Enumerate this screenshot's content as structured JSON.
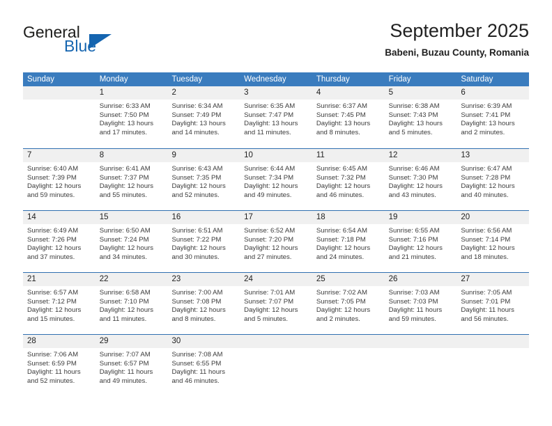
{
  "brand": {
    "word1": "General",
    "word2": "Blue",
    "logo_icon": "blue-triangle-icon",
    "accent_color": "#1565b0"
  },
  "header": {
    "title": "September 2025",
    "location": "Babeni, Buzau County, Romania"
  },
  "calendar": {
    "header_bg": "#3a7cbe",
    "row_divider": "#2f6fb0",
    "date_band_bg": "#f0f0f0",
    "weekdays": [
      "Sunday",
      "Monday",
      "Tuesday",
      "Wednesday",
      "Thursday",
      "Friday",
      "Saturday"
    ],
    "weeks": [
      [
        {
          "date": "",
          "sunrise": "",
          "sunset": "",
          "daylight_line1": "",
          "daylight_line2": "",
          "empty": true
        },
        {
          "date": "1",
          "sunrise": "Sunrise: 6:33 AM",
          "sunset": "Sunset: 7:50 PM",
          "daylight_line1": "Daylight: 13 hours",
          "daylight_line2": "and 17 minutes."
        },
        {
          "date": "2",
          "sunrise": "Sunrise: 6:34 AM",
          "sunset": "Sunset: 7:49 PM",
          "daylight_line1": "Daylight: 13 hours",
          "daylight_line2": "and 14 minutes."
        },
        {
          "date": "3",
          "sunrise": "Sunrise: 6:35 AM",
          "sunset": "Sunset: 7:47 PM",
          "daylight_line1": "Daylight: 13 hours",
          "daylight_line2": "and 11 minutes."
        },
        {
          "date": "4",
          "sunrise": "Sunrise: 6:37 AM",
          "sunset": "Sunset: 7:45 PM",
          "daylight_line1": "Daylight: 13 hours",
          "daylight_line2": "and 8 minutes."
        },
        {
          "date": "5",
          "sunrise": "Sunrise: 6:38 AM",
          "sunset": "Sunset: 7:43 PM",
          "daylight_line1": "Daylight: 13 hours",
          "daylight_line2": "and 5 minutes."
        },
        {
          "date": "6",
          "sunrise": "Sunrise: 6:39 AM",
          "sunset": "Sunset: 7:41 PM",
          "daylight_line1": "Daylight: 13 hours",
          "daylight_line2": "and 2 minutes."
        }
      ],
      [
        {
          "date": "7",
          "sunrise": "Sunrise: 6:40 AM",
          "sunset": "Sunset: 7:39 PM",
          "daylight_line1": "Daylight: 12 hours",
          "daylight_line2": "and 59 minutes."
        },
        {
          "date": "8",
          "sunrise": "Sunrise: 6:41 AM",
          "sunset": "Sunset: 7:37 PM",
          "daylight_line1": "Daylight: 12 hours",
          "daylight_line2": "and 55 minutes."
        },
        {
          "date": "9",
          "sunrise": "Sunrise: 6:43 AM",
          "sunset": "Sunset: 7:35 PM",
          "daylight_line1": "Daylight: 12 hours",
          "daylight_line2": "and 52 minutes."
        },
        {
          "date": "10",
          "sunrise": "Sunrise: 6:44 AM",
          "sunset": "Sunset: 7:34 PM",
          "daylight_line1": "Daylight: 12 hours",
          "daylight_line2": "and 49 minutes."
        },
        {
          "date": "11",
          "sunrise": "Sunrise: 6:45 AM",
          "sunset": "Sunset: 7:32 PM",
          "daylight_line1": "Daylight: 12 hours",
          "daylight_line2": "and 46 minutes."
        },
        {
          "date": "12",
          "sunrise": "Sunrise: 6:46 AM",
          "sunset": "Sunset: 7:30 PM",
          "daylight_line1": "Daylight: 12 hours",
          "daylight_line2": "and 43 minutes."
        },
        {
          "date": "13",
          "sunrise": "Sunrise: 6:47 AM",
          "sunset": "Sunset: 7:28 PM",
          "daylight_line1": "Daylight: 12 hours",
          "daylight_line2": "and 40 minutes."
        }
      ],
      [
        {
          "date": "14",
          "sunrise": "Sunrise: 6:49 AM",
          "sunset": "Sunset: 7:26 PM",
          "daylight_line1": "Daylight: 12 hours",
          "daylight_line2": "and 37 minutes."
        },
        {
          "date": "15",
          "sunrise": "Sunrise: 6:50 AM",
          "sunset": "Sunset: 7:24 PM",
          "daylight_line1": "Daylight: 12 hours",
          "daylight_line2": "and 34 minutes."
        },
        {
          "date": "16",
          "sunrise": "Sunrise: 6:51 AM",
          "sunset": "Sunset: 7:22 PM",
          "daylight_line1": "Daylight: 12 hours",
          "daylight_line2": "and 30 minutes."
        },
        {
          "date": "17",
          "sunrise": "Sunrise: 6:52 AM",
          "sunset": "Sunset: 7:20 PM",
          "daylight_line1": "Daylight: 12 hours",
          "daylight_line2": "and 27 minutes."
        },
        {
          "date": "18",
          "sunrise": "Sunrise: 6:54 AM",
          "sunset": "Sunset: 7:18 PM",
          "daylight_line1": "Daylight: 12 hours",
          "daylight_line2": "and 24 minutes."
        },
        {
          "date": "19",
          "sunrise": "Sunrise: 6:55 AM",
          "sunset": "Sunset: 7:16 PM",
          "daylight_line1": "Daylight: 12 hours",
          "daylight_line2": "and 21 minutes."
        },
        {
          "date": "20",
          "sunrise": "Sunrise: 6:56 AM",
          "sunset": "Sunset: 7:14 PM",
          "daylight_line1": "Daylight: 12 hours",
          "daylight_line2": "and 18 minutes."
        }
      ],
      [
        {
          "date": "21",
          "sunrise": "Sunrise: 6:57 AM",
          "sunset": "Sunset: 7:12 PM",
          "daylight_line1": "Daylight: 12 hours",
          "daylight_line2": "and 15 minutes."
        },
        {
          "date": "22",
          "sunrise": "Sunrise: 6:58 AM",
          "sunset": "Sunset: 7:10 PM",
          "daylight_line1": "Daylight: 12 hours",
          "daylight_line2": "and 11 minutes."
        },
        {
          "date": "23",
          "sunrise": "Sunrise: 7:00 AM",
          "sunset": "Sunset: 7:08 PM",
          "daylight_line1": "Daylight: 12 hours",
          "daylight_line2": "and 8 minutes."
        },
        {
          "date": "24",
          "sunrise": "Sunrise: 7:01 AM",
          "sunset": "Sunset: 7:07 PM",
          "daylight_line1": "Daylight: 12 hours",
          "daylight_line2": "and 5 minutes."
        },
        {
          "date": "25",
          "sunrise": "Sunrise: 7:02 AM",
          "sunset": "Sunset: 7:05 PM",
          "daylight_line1": "Daylight: 12 hours",
          "daylight_line2": "and 2 minutes."
        },
        {
          "date": "26",
          "sunrise": "Sunrise: 7:03 AM",
          "sunset": "Sunset: 7:03 PM",
          "daylight_line1": "Daylight: 11 hours",
          "daylight_line2": "and 59 minutes."
        },
        {
          "date": "27",
          "sunrise": "Sunrise: 7:05 AM",
          "sunset": "Sunset: 7:01 PM",
          "daylight_line1": "Daylight: 11 hours",
          "daylight_line2": "and 56 minutes."
        }
      ],
      [
        {
          "date": "28",
          "sunrise": "Sunrise: 7:06 AM",
          "sunset": "Sunset: 6:59 PM",
          "daylight_line1": "Daylight: 11 hours",
          "daylight_line2": "and 52 minutes."
        },
        {
          "date": "29",
          "sunrise": "Sunrise: 7:07 AM",
          "sunset": "Sunset: 6:57 PM",
          "daylight_line1": "Daylight: 11 hours",
          "daylight_line2": "and 49 minutes."
        },
        {
          "date": "30",
          "sunrise": "Sunrise: 7:08 AM",
          "sunset": "Sunset: 6:55 PM",
          "daylight_line1": "Daylight: 11 hours",
          "daylight_line2": "and 46 minutes."
        },
        {
          "date": "",
          "sunrise": "",
          "sunset": "",
          "daylight_line1": "",
          "daylight_line2": "",
          "empty": true
        },
        {
          "date": "",
          "sunrise": "",
          "sunset": "",
          "daylight_line1": "",
          "daylight_line2": "",
          "empty": true
        },
        {
          "date": "",
          "sunrise": "",
          "sunset": "",
          "daylight_line1": "",
          "daylight_line2": "",
          "empty": true
        },
        {
          "date": "",
          "sunrise": "",
          "sunset": "",
          "daylight_line1": "",
          "daylight_line2": "",
          "empty": true
        }
      ]
    ]
  }
}
